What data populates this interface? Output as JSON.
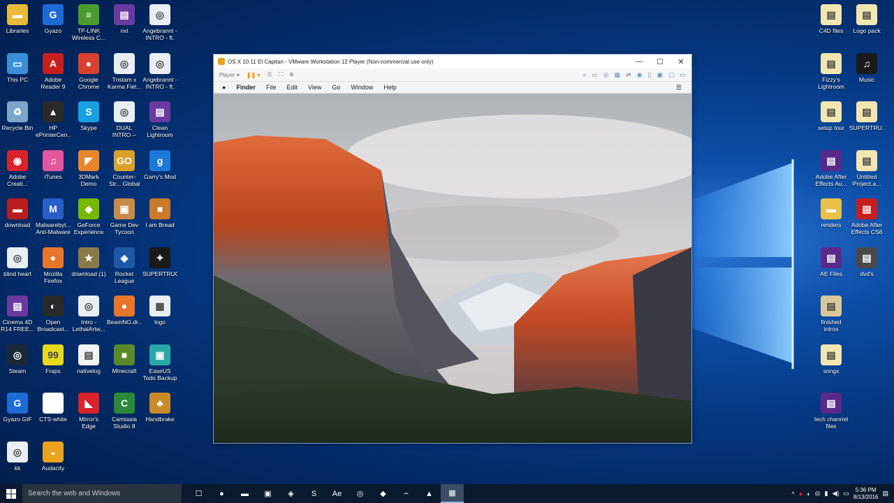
{
  "desktop_left": [
    {
      "label": "Libraries",
      "color": "#e8b93a",
      "glyph": "▬"
    },
    {
      "label": "Gyazo",
      "color": "#1e6bd6",
      "glyph": "G"
    },
    {
      "label": "TP-LINK Wireless C...",
      "color": "#4a9c2e",
      "glyph": "≡"
    },
    {
      "label": "nxt",
      "color": "#6b3aa0",
      "glyph": "▤"
    },
    {
      "label": "Angebrannt - INTRO - ft. ...",
      "color": "#e9eef3",
      "glyph": "◎"
    },
    {
      "label": "This PC",
      "color": "#3a8fd6",
      "glyph": "▭"
    },
    {
      "label": "Adobe Reader 9",
      "color": "#c81e1e",
      "glyph": "A"
    },
    {
      "label": "Google Chrome",
      "color": "#d9412e",
      "glyph": "●"
    },
    {
      "label": "Tristam x Karma Fiel...",
      "color": "#e9eef3",
      "glyph": "◎"
    },
    {
      "label": "Angebrannt - INTRO - ft. ...",
      "color": "#e9eef3",
      "glyph": "◎"
    },
    {
      "label": "Recycle Bin",
      "color": "#7aa6c9",
      "glyph": "♻"
    },
    {
      "label": "HP ePrinterCen...",
      "color": "#2a2a2a",
      "glyph": "▲"
    },
    {
      "label": "Skype",
      "color": "#18a0e0",
      "glyph": "S"
    },
    {
      "label": "DUAL INTRO -- AskAga...",
      "color": "#e9eef3",
      "glyph": "◎"
    },
    {
      "label": "Clean Lightroom",
      "color": "#6b3aa0",
      "glyph": "▤"
    },
    {
      "label": "Adobe Creati...",
      "color": "#d8232a",
      "glyph": "◉"
    },
    {
      "label": "iTunes",
      "color": "#e4569b",
      "glyph": "♫"
    },
    {
      "label": "3DMark Demo",
      "color": "#e8862a",
      "glyph": "◤"
    },
    {
      "label": "Counter-Str... Global Offe...",
      "color": "#d9a02a",
      "glyph": "GO"
    },
    {
      "label": "Garry's Mod",
      "color": "#1e78d8",
      "glyph": "g"
    },
    {
      "label": "download",
      "color": "#b81e1e",
      "glyph": "▬"
    },
    {
      "label": "Malwarebyt... Anti-Malware",
      "color": "#2a5ec8",
      "glyph": "M"
    },
    {
      "label": "GeForce Experience",
      "color": "#76b900",
      "glyph": "◆"
    },
    {
      "label": "Game Dev Tycoon",
      "color": "#c98a4a",
      "glyph": "▣"
    },
    {
      "label": "I am Bread",
      "color": "#c97a2a",
      "glyph": "■"
    },
    {
      "label": "blind heart",
      "color": "#e9eef3",
      "glyph": "◎"
    },
    {
      "label": "Mozilla Firefox",
      "color": "#e8762a",
      "glyph": "●"
    },
    {
      "label": "download (1)",
      "color": "#8a7a4a",
      "glyph": "★"
    },
    {
      "label": "Rocket League",
      "color": "#1e58a8",
      "glyph": "◈"
    },
    {
      "label": "SUPERTRUCK",
      "color": "#1a1a1a",
      "glyph": "✦"
    },
    {
      "label": "Cinema 4D R14 FREE...",
      "color": "#6b3aa0",
      "glyph": "▤"
    },
    {
      "label": "Open Broadcast...",
      "color": "#2a2a2a",
      "glyph": "◐"
    },
    {
      "label": "Intro - LethalArtw...",
      "color": "#e9eef3",
      "glyph": "◎"
    },
    {
      "label": "BeamNG.dr...",
      "color": "#e8762a",
      "glyph": "●"
    },
    {
      "label": "logo",
      "color": "#e9eef3",
      "glyph": "▦"
    },
    {
      "label": "Steam",
      "color": "#1b2838",
      "glyph": "◎"
    },
    {
      "label": "Fraps",
      "color": "#e8d81e",
      "glyph": "99"
    },
    {
      "label": "nativelog",
      "color": "#f2f2f2",
      "glyph": "▤"
    },
    {
      "label": "Minecraft",
      "color": "#5a8a2a",
      "glyph": "■"
    },
    {
      "label": "EaseUS Todo Backup Fre...",
      "color": "#2aa8a8",
      "glyph": "▣"
    },
    {
      "label": "Gyazo GIF",
      "color": "#1e6bd6",
      "glyph": "G"
    },
    {
      "label": "CTS-white",
      "color": "#ffffff",
      "glyph": ""
    },
    {
      "label": "Mirror's Edge",
      "color": "#d8232a",
      "glyph": "◣"
    },
    {
      "label": "Camtasia Studio 8",
      "color": "#2a8a3a",
      "glyph": "C"
    },
    {
      "label": "Handbrake",
      "color": "#c98a2a",
      "glyph": "♣"
    },
    {
      "label": "kk",
      "color": "#e9eef3",
      "glyph": "◎"
    },
    {
      "label": "Audacity",
      "color": "#e8a21e",
      "glyph": "◒"
    }
  ],
  "desktop_right": [
    {
      "label": "C4D files",
      "color": "#f2e6b0",
      "glyph": "▤"
    },
    {
      "label": "Logo pack",
      "color": "#f2e6b0",
      "glyph": "▤"
    },
    {
      "label": "Fizzy's Lightroom",
      "color": "#f2e6b0",
      "glyph": "▤"
    },
    {
      "label": "Music",
      "color": "#1a1a1a",
      "glyph": "♫"
    },
    {
      "label": "setup tour",
      "color": "#f2e6b0",
      "glyph": "▤"
    },
    {
      "label": "SUPERTRU...",
      "color": "#f2e6b0",
      "glyph": "▤"
    },
    {
      "label": "Adobe After Effects Au...",
      "color": "#5a2a8a",
      "glyph": "▤"
    },
    {
      "label": "Untitled Project.a...",
      "color": "#f2e6b0",
      "glyph": "▤"
    },
    {
      "label": "renders",
      "color": "#e8c04a",
      "glyph": "▬"
    },
    {
      "label": "Adobe After Effects CS6",
      "color": "#c81e1e",
      "glyph": "▤"
    },
    {
      "label": "AE Files",
      "color": "#5a2a8a",
      "glyph": "▤"
    },
    {
      "label": "dvd's",
      "color": "#4a4a4a",
      "glyph": "▤"
    },
    {
      "label": "finished intros",
      "color": "#d8c89a",
      "glyph": "▤"
    },
    {
      "label": "songs",
      "color": "#f2e6b0",
      "glyph": "▤"
    },
    {
      "label": "tech channel files",
      "color": "#5a2a8a",
      "glyph": "▤"
    }
  ],
  "vm_window": {
    "title": "OS X 10.11 El Capitan - VMware Workstation 12 Player (Non-commercial use only)",
    "player_menu": "Player ▾",
    "minimize": "—",
    "maximize": "☐",
    "close": "✕"
  },
  "mac_menu": {
    "apple": "",
    "items": [
      "Finder",
      "File",
      "Edit",
      "View",
      "Go",
      "Window",
      "Help"
    ]
  },
  "taskbar": {
    "search_placeholder": "Search the web and Windows",
    "time": "5:36 PM",
    "date": "8/13/2016",
    "apps": [
      {
        "name": "task-view",
        "glyph": "☐"
      },
      {
        "name": "chrome",
        "glyph": "●"
      },
      {
        "name": "file-explorer",
        "glyph": "▬"
      },
      {
        "name": "store",
        "glyph": "▣"
      },
      {
        "name": "security",
        "glyph": "◈"
      },
      {
        "name": "skype",
        "glyph": "S"
      },
      {
        "name": "after-effects",
        "glyph": "Ae"
      },
      {
        "name": "steam",
        "glyph": "◎"
      },
      {
        "name": "app",
        "glyph": "◆"
      },
      {
        "name": "app2",
        "glyph": "⌢"
      },
      {
        "name": "app3",
        "glyph": "▲"
      },
      {
        "name": "vmware",
        "glyph": "▦"
      }
    ]
  }
}
